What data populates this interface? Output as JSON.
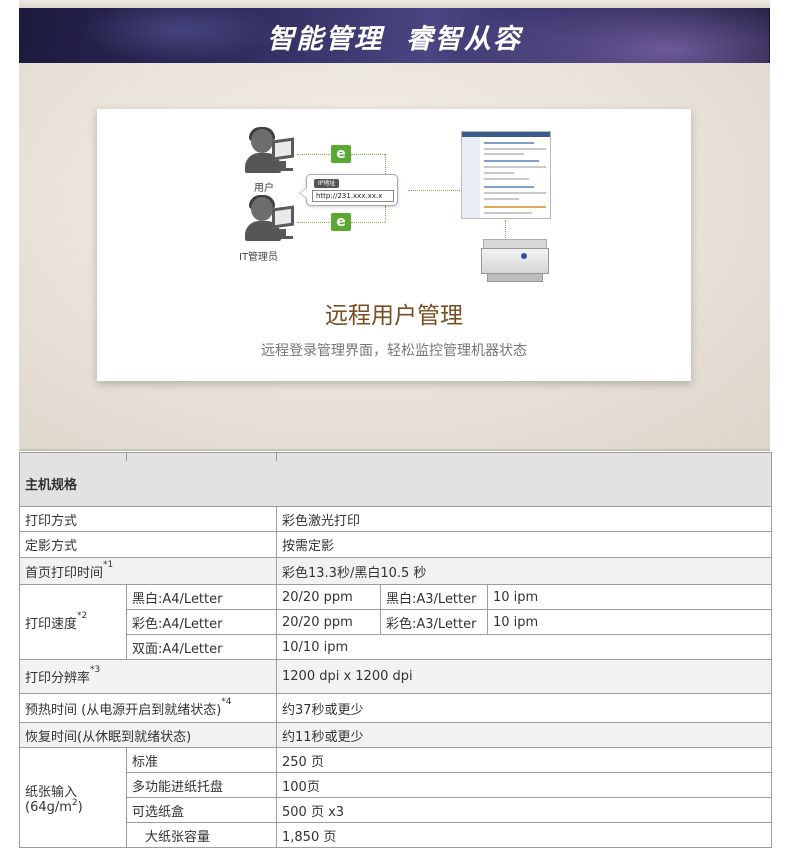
{
  "banner": {
    "title": "智能管理  睿智从容"
  },
  "feature_card": {
    "diagram": {
      "user_label": "用户",
      "admin_label": "IT管理员",
      "badge_icon": "e-browser-icon",
      "ip_tag": "IP地址",
      "ip_url": "http://231.xxx.xx.x"
    },
    "title": "远程用户管理",
    "subtitle": "远程登录管理界面，轻松监控管理机器状态"
  },
  "spec_table": {
    "section_title": "主机规格",
    "rows": {
      "print_method": {
        "label": "打印方式",
        "value": "彩色激光打印"
      },
      "fixing_method": {
        "label": "定影方式",
        "value": "按需定影"
      },
      "first_page": {
        "label": "首页打印时间",
        "note": "*1",
        "value": "彩色13.3秒/黑白10.5 秒"
      },
      "print_speed": {
        "label": "打印速度",
        "note": "*2",
        "bw_a4_label": "黑白:A4/Letter",
        "bw_a4_value": "20/20 ppm",
        "bw_a3_label": "黑白:A3/Letter",
        "bw_a3_value": "10 ipm",
        "color_a4_label": "彩色:A4/Letter",
        "color_a4_value": "20/20 ppm",
        "color_a3_label": "彩色:A3/Letter",
        "color_a3_value": "10 ipm",
        "duplex_label": "双面:A4/Letter",
        "duplex_value": "10/10 ipm"
      },
      "resolution": {
        "label": "打印分辨率",
        "note": "*3",
        "value": "1200 dpi x 1200 dpi"
      },
      "warmup": {
        "label": "预热时间 (从电源开启到就绪状态)",
        "note": "*4",
        "value": "约37秒或更少"
      },
      "recovery": {
        "label": "恢复时间(从休眠到就绪状态)",
        "value": "约11秒或更少"
      },
      "paper_input": {
        "label_line1": "纸张输入",
        "label_line2_prefix": "(64g/m",
        "label_line2_sup": "2",
        "label_line2_suffix": ")",
        "standard_label": "标准",
        "standard_value": "250 页",
        "mp_tray_label": "多功能进纸托盘",
        "mp_tray_value": "100页",
        "optional_label": "可选纸盒",
        "optional_value": "500 页 x3",
        "max_label": "大纸张容量",
        "max_value": "1,850 页"
      }
    }
  }
}
